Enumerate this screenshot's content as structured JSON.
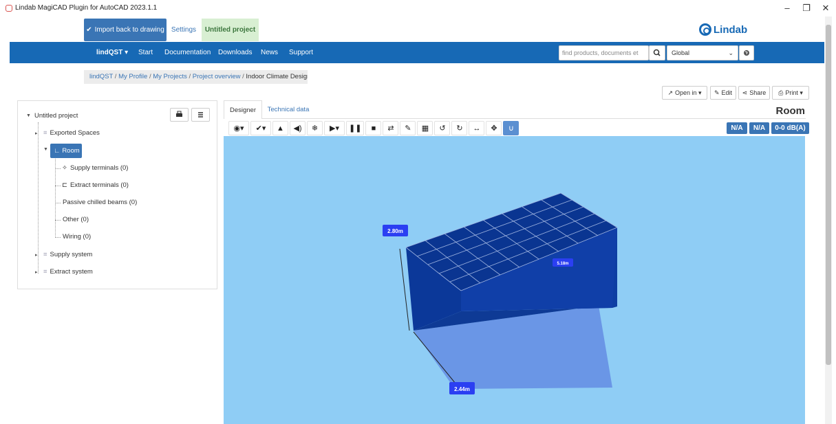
{
  "window": {
    "title": "Lindab MagiCAD Plugin for AutoCAD 2023.1.1",
    "minimize": "–",
    "restore": "❐",
    "close": "✕"
  },
  "top_actions": {
    "import_label": "Import back to drawing",
    "settings_label": "Settings",
    "project_label": "Untitled project"
  },
  "brand": {
    "name": "Lindab"
  },
  "navbar": {
    "items": [
      "lindQST ▾",
      "Start",
      "Documentation",
      "Downloads",
      "News",
      "Support"
    ],
    "search_placeholder": "find products, documents et",
    "region": "Global"
  },
  "breadcrumb": {
    "items": [
      "lindQST",
      "My Profile",
      "My Projects",
      "Project overview"
    ],
    "current": "Indoor Climate Designer"
  },
  "actions": {
    "open_in": "Open in ▾",
    "edit": "Edit",
    "share": "Share",
    "print": "Print ▾"
  },
  "tree": {
    "root": "Untitled project",
    "exported_spaces": "Exported Spaces",
    "room": "Room",
    "children": [
      "Supply terminals (0)",
      "Extract terminals (0)",
      "Passive chilled beams (0)",
      "Other (0)",
      "Wiring (0)"
    ],
    "supply_system": "Supply system",
    "extract_system": "Extract system"
  },
  "designer": {
    "tabs": [
      "Designer",
      "Technical data"
    ],
    "title": "Room",
    "badges": [
      "N/A",
      "N/A",
      "0-0 dB(A)"
    ],
    "dimensions": {
      "height": "2.80m",
      "length": "5.18m",
      "width": "2.44m"
    }
  },
  "colors": {
    "brand_blue": "#1769b5",
    "button_blue": "#3a75b5",
    "viewport_bg": "#8fcdf5",
    "room_dark": "#0a3591",
    "floor": "#6a96e6"
  }
}
